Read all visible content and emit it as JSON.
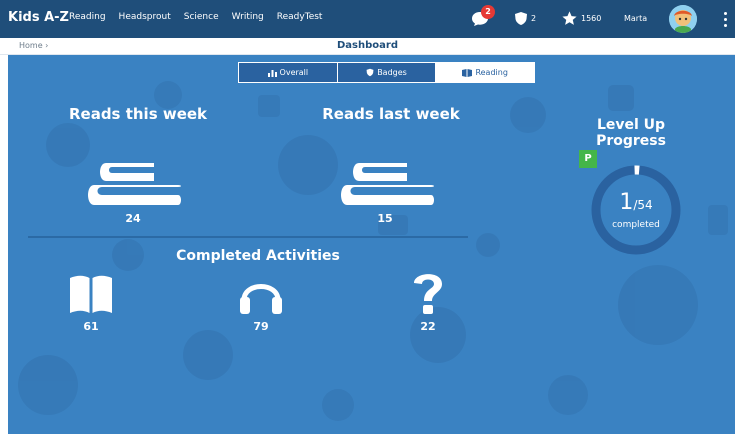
{
  "app": {
    "brand": "Kids A-Z"
  },
  "nav": {
    "items": [
      "Reading",
      "Headsprout",
      "Science",
      "Writing",
      "ReadyTest"
    ]
  },
  "header": {
    "messages_count": "2",
    "badges_count": "2",
    "stars_count": "1560",
    "user_name": "Marta"
  },
  "breadcrumb": {
    "home": "Home ›"
  },
  "page": {
    "title": "Dashboard"
  },
  "tabs": [
    {
      "label": "Overall",
      "icon": "bar-chart-icon"
    },
    {
      "label": "Badges",
      "icon": "shield-icon"
    },
    {
      "label": "Reading",
      "icon": "book-icon"
    }
  ],
  "stats": {
    "reads_this_week": {
      "label": "Reads this week",
      "value": "24"
    },
    "reads_last_week": {
      "label": "Reads last week",
      "value": "15"
    }
  },
  "completed": {
    "title": "Completed Activities",
    "books": "61",
    "listens": "79",
    "quizzes": "22"
  },
  "level": {
    "title": "Level Up Progress",
    "level_letter": "P",
    "current": "1",
    "total": "/54",
    "label": "completed",
    "fraction": 0.0185
  },
  "colors": {
    "topbar": "#1f4e7a",
    "main": "#3a82c2",
    "level_badge": "#44b649",
    "notify": "#e53935"
  }
}
